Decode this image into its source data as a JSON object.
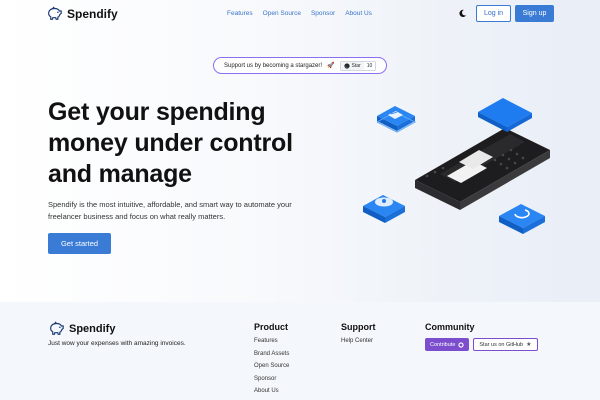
{
  "brand": {
    "name": "Spendify",
    "icon": "piggy-bank-icon",
    "accent": "#3a7bd5"
  },
  "nav": {
    "links": [
      "Features",
      "Open Source",
      "Sponsor",
      "About Us"
    ],
    "theme_icon": "moon-icon",
    "login_label": "Log in",
    "signup_label": "Sign up"
  },
  "stargazer": {
    "text": "Support us by becoming a stargazer!",
    "icon": "rocket-icon",
    "star_label": "Star",
    "star_count": "10",
    "border_color": "#8b6ff0"
  },
  "hero": {
    "title_lines": [
      "Get your spending",
      "money under control",
      "and manage"
    ],
    "subtitle_lines": [
      "Spendify is the most intuitive, affordable, and smart way to automate your",
      "freelancer business and focus on what really matters."
    ],
    "cta_label": "Get started"
  },
  "footer": {
    "brand_name": "Spendify",
    "tagline": "Just wow your expenses with amazing invoices.",
    "product": {
      "title": "Product",
      "links": [
        "Features",
        "Brand Assets",
        "Open Source",
        "Sponsor",
        "About Us"
      ]
    },
    "support": {
      "title": "Support",
      "links": [
        "Help Center"
      ]
    },
    "community": {
      "title": "Community",
      "contribute_label": "Contribute",
      "contribute_icon": "github-icon",
      "contribute_color": "#7c4dcc",
      "star_label": "Star us on GitHub",
      "star_icon": "star-icon"
    }
  }
}
